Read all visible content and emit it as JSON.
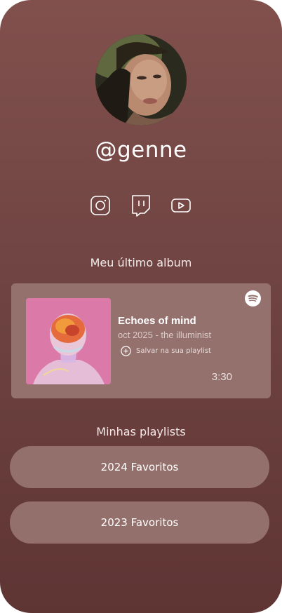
{
  "profile": {
    "handle": "@genne",
    "avatar_alt": "profile-photo"
  },
  "socials": [
    {
      "icon": "instagram-icon"
    },
    {
      "icon": "twitch-icon"
    },
    {
      "icon": "youtube-icon"
    }
  ],
  "latest_album": {
    "section_title": "Meu último album",
    "title": "Echoes of mind",
    "subtitle": "oct 2025 - the illuminist",
    "save_label": "Salvar na sua playlist",
    "duration": "3:30",
    "service_icon": "spotify-icon"
  },
  "playlists": {
    "section_title": "Minhas playlists",
    "items": [
      {
        "label": "2024 Favoritos"
      },
      {
        "label": "2023 Favoritos"
      }
    ]
  },
  "colors": {
    "background_top": "#81504d",
    "background_bottom": "#5f3534",
    "card": "#94716d",
    "button": "#93706c",
    "text": "#ffffff"
  }
}
